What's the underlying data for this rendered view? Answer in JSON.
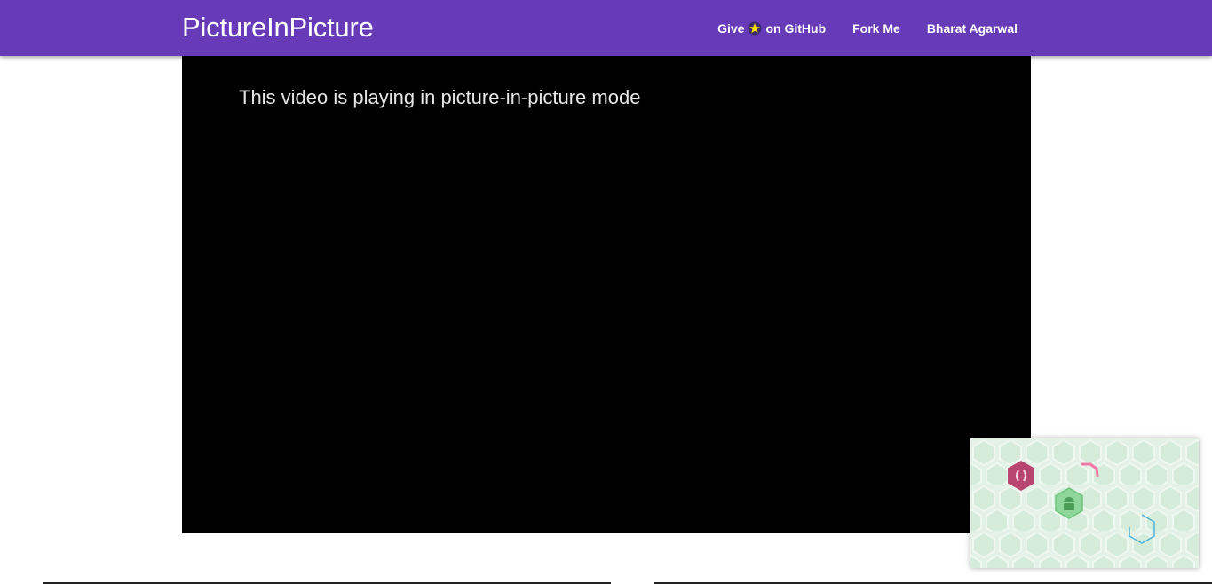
{
  "app": {
    "brand": "PictureInPicture"
  },
  "nav": {
    "github_prefix": "Give",
    "github_icon": "star-icon",
    "github_suffix": "on GitHub",
    "fork": "Fork Me",
    "author": "Bharat Agarwal"
  },
  "video": {
    "message": "This video is playing in picture-in-picture mode"
  },
  "pip_window": {
    "icons": [
      "hexagon-code-icon",
      "hexagon-android-icon",
      "hexagon-outline-icon"
    ]
  },
  "colors": {
    "header": "#673ab7",
    "video_bg": "#000000",
    "pip_bg": "#e3f1e7",
    "hex_pink": "#b8456f",
    "hex_green": "#6cc57a",
    "hex_blue": "#4fb3d9"
  }
}
